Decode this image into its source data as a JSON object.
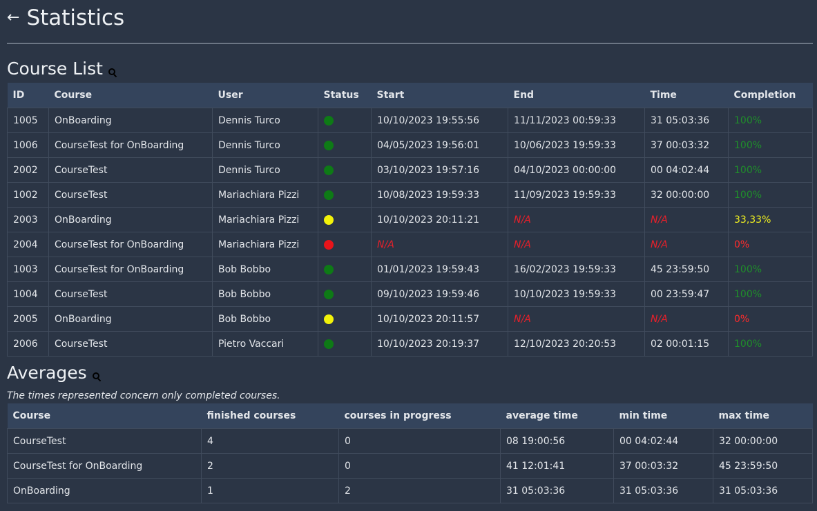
{
  "header": {
    "back_icon": "arrow-left-icon",
    "title": "Statistics"
  },
  "course_list": {
    "title": "Course List",
    "search_icon": "search-icon",
    "columns": [
      "ID",
      "Course",
      "User",
      "Status",
      "Start",
      "End",
      "Time",
      "Completion"
    ],
    "status_colors": {
      "green": "#0e7a16",
      "yellow": "#f2f20a",
      "red": "#e8141a"
    },
    "completion_colors": {
      "100%": "#1f8f2a",
      "33,33%": "#f0f020",
      "0%": "#ff2b2b"
    },
    "rows": [
      {
        "id": "1005",
        "course": "OnBoarding",
        "user": "Dennis Turco",
        "status": "green",
        "start": "10/10/2023 19:55:56",
        "end": "11/11/2023 00:59:33",
        "time": "31 05:03:36",
        "completion": "100%"
      },
      {
        "id": "1006",
        "course": "CourseTest for OnBoarding",
        "user": "Dennis Turco",
        "status": "green",
        "start": "04/05/2023 19:56:01",
        "end": "10/06/2023 19:59:33",
        "time": "37 00:03:32",
        "completion": "100%"
      },
      {
        "id": "2002",
        "course": "CourseTest",
        "user": "Dennis Turco",
        "status": "green",
        "start": "03/10/2023 19:57:16",
        "end": "04/10/2023 00:00:00",
        "time": "00 04:02:44",
        "completion": "100%"
      },
      {
        "id": "1002",
        "course": "CourseTest",
        "user": "Mariachiara Pizzi",
        "status": "green",
        "start": "10/08/2023 19:59:33",
        "end": "11/09/2023 19:59:33",
        "time": "32 00:00:00",
        "completion": "100%"
      },
      {
        "id": "2003",
        "course": "OnBoarding",
        "user": "Mariachiara Pizzi",
        "status": "yellow",
        "start": "10/10/2023 20:11:21",
        "end": "N/A",
        "time": "N/A",
        "completion": "33,33%"
      },
      {
        "id": "2004",
        "course": "CourseTest for OnBoarding",
        "user": "Mariachiara Pizzi",
        "status": "red",
        "start": "N/A",
        "end": "N/A",
        "time": "N/A",
        "completion": "0%"
      },
      {
        "id": "1003",
        "course": "CourseTest for OnBoarding",
        "user": "Bob Bobbo",
        "status": "green",
        "start": "01/01/2023 19:59:43",
        "end": "16/02/2023 19:59:33",
        "time": "45 23:59:50",
        "completion": "100%"
      },
      {
        "id": "1004",
        "course": "CourseTest",
        "user": "Bob Bobbo",
        "status": "green",
        "start": "09/10/2023 19:59:46",
        "end": "10/10/2023 19:59:33",
        "time": "00 23:59:47",
        "completion": "100%"
      },
      {
        "id": "2005",
        "course": "OnBoarding",
        "user": "Bob Bobbo",
        "status": "yellow",
        "start": "10/10/2023 20:11:57",
        "end": "N/A",
        "time": "N/A",
        "completion": "0%"
      },
      {
        "id": "2006",
        "course": "CourseTest",
        "user": "Pietro Vaccari",
        "status": "green",
        "start": "10/10/2023 20:19:37",
        "end": "12/10/2023 20:20:53",
        "time": "02 00:01:15",
        "completion": "100%"
      }
    ]
  },
  "averages": {
    "title": "Averages",
    "search_icon": "search-icon",
    "note": "The times represented concern only completed courses.",
    "columns": [
      "Course",
      "finished courses",
      "courses in progress",
      "average time",
      "min time",
      "max time"
    ],
    "rows": [
      {
        "course": "CourseTest",
        "finished": "4",
        "in_progress": "0",
        "avg": "08 19:00:56",
        "min": "00 04:02:44",
        "max": "32 00:00:00"
      },
      {
        "course": "CourseTest for OnBoarding",
        "finished": "2",
        "in_progress": "0",
        "avg": "41 12:01:41",
        "min": "37 00:03:32",
        "max": "45 23:59:50"
      },
      {
        "course": "OnBoarding",
        "finished": "1",
        "in_progress": "2",
        "avg": "31 05:03:36",
        "min": "31 05:03:36",
        "max": "31 05:03:36"
      }
    ]
  }
}
